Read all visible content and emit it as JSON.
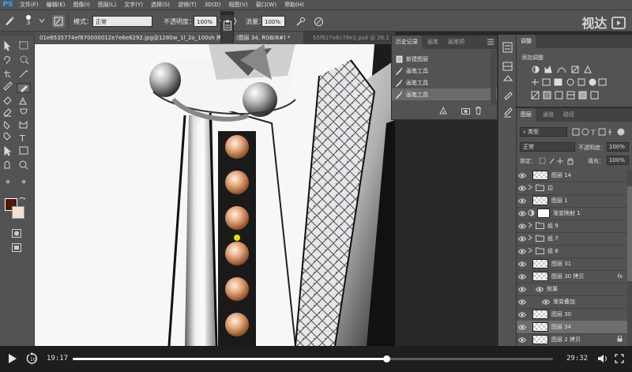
{
  "app": {
    "logo": "PS"
  },
  "menu": [
    "文件(F)",
    "编辑(E)",
    "图像(I)",
    "图层(L)",
    "文字(Y)",
    "选择(S)",
    "滤镜(T)",
    "3D(D)",
    "视图(V)",
    "窗口(W)",
    "帮助(H)"
  ],
  "options": {
    "brush_size": "3",
    "mode_label": "模式：",
    "mode_value": "正常",
    "opacity_label": "不透明度：",
    "opacity_value": "100%",
    "flow_label": "流量：",
    "flow_value": "100%"
  },
  "tabs": [
    {
      "label": "01e6535774ef870000012e7e6e6292.jpg@1280w_1l_2o_100sh 拷贝 % (图层 34, RGB/8#) *",
      "active": true
    },
    {
      "label": "55f627e6c78e2.psd @ 26.1",
      "active": false
    }
  ],
  "history": {
    "tabs": [
      "历史记录",
      "画笔",
      "画笔预"
    ],
    "items": [
      {
        "label": "新建图层",
        "icon": "document-icon"
      },
      {
        "label": "画笔工具",
        "icon": "brush-icon"
      },
      {
        "label": "画笔工具",
        "icon": "brush-icon"
      },
      {
        "label": "画笔工具",
        "icon": "brush-icon",
        "selected": true
      }
    ]
  },
  "adjustments": {
    "tab": "调整",
    "title": "添加调整"
  },
  "layers": {
    "tabs": [
      "图层",
      "通道",
      "路径"
    ],
    "filter_kind": "类型",
    "blend_mode": "正常",
    "opacity_label": "不透明度：",
    "opacity_value": "100%",
    "lock_label": "锁定：",
    "fill_label": "填充：",
    "fill_value": "100%",
    "rows": [
      {
        "name": "图层 14",
        "type": "layer"
      },
      {
        "name": "边",
        "type": "group"
      },
      {
        "name": "图层 1",
        "type": "layer"
      },
      {
        "name": "渐变映射 1",
        "type": "adjustment"
      },
      {
        "name": "组 9",
        "type": "group"
      },
      {
        "name": "组 7",
        "type": "group"
      },
      {
        "name": "组 8",
        "type": "group"
      },
      {
        "name": "图层 31",
        "type": "layer"
      },
      {
        "name": "图层 30 拷贝",
        "type": "layer",
        "fx": "fx"
      },
      {
        "name": "效果",
        "type": "effect"
      },
      {
        "name": "渐变叠加",
        "type": "effect"
      },
      {
        "name": "图层 30",
        "type": "layer"
      },
      {
        "name": "图层 34",
        "type": "layer",
        "selected": true
      },
      {
        "name": "图层 2 拷贝",
        "type": "layer"
      }
    ]
  },
  "video": {
    "current_time": "19:17",
    "total_time": "29:32",
    "progress": 0.653
  },
  "watermark": "视达",
  "colors": {
    "foreground": "#4a1a08",
    "background": "#f5e1d2",
    "accent": "#31a8ff"
  }
}
